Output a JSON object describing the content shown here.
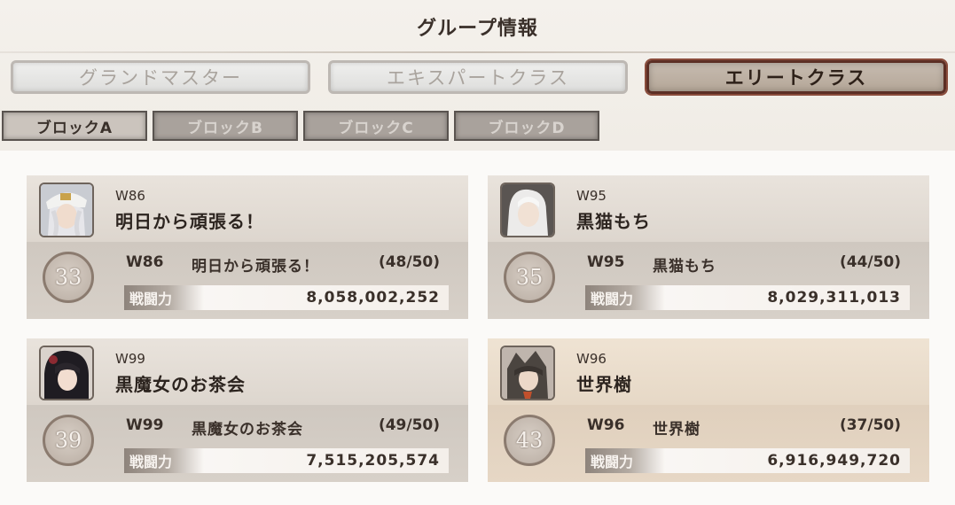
{
  "header": {
    "title": "グループ情報"
  },
  "tabs": [
    {
      "label": "グランドマスター",
      "active": false
    },
    {
      "label": "エキスパートクラス",
      "active": false
    },
    {
      "label": "エリートクラス",
      "active": true
    }
  ],
  "blocks": [
    {
      "label": "ブロックA",
      "active": true
    },
    {
      "label": "ブロックB",
      "active": false
    },
    {
      "label": "ブロックC",
      "active": false
    },
    {
      "label": "ブロックD",
      "active": false
    }
  ],
  "power_label": "戦闘力",
  "cards": [
    {
      "world": "W86",
      "name": "明日から頑張る！",
      "rank": "33",
      "count": "(48/50)",
      "power": "8,058,002,252"
    },
    {
      "world": "W95",
      "name": "黒猫もち",
      "rank": "35",
      "count": "(44/50)",
      "power": "8,029,311,013"
    },
    {
      "world": "W99",
      "name": "黒魔女のお茶会",
      "rank": "39",
      "count": "(49/50)",
      "power": "7,515,205,574"
    },
    {
      "world": "W96",
      "name": "世界樹",
      "rank": "43",
      "count": "(37/50)",
      "power": "6,916,949,720"
    }
  ]
}
